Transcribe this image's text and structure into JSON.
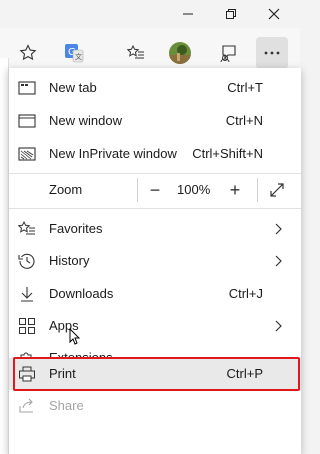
{
  "window": {
    "minimize_icon": "minimize-icon",
    "restore_icon": "restore-icon",
    "close_icon": "close-icon"
  },
  "toolbar": {
    "favorite_icon": "star-icon",
    "translate_icon": "translate-icon",
    "favorites_list_icon": "favorites-list-icon",
    "avatar_icon": "avatar",
    "feedback_icon": "feedback-icon",
    "more_icon": "more-icon"
  },
  "menu": {
    "items": [
      {
        "label": "New tab",
        "shortcut": "Ctrl+T",
        "icon": "new-tab-icon"
      },
      {
        "label": "New window",
        "shortcut": "Ctrl+N",
        "icon": "new-window-icon"
      },
      {
        "label": "New InPrivate window",
        "shortcut": "Ctrl+Shift+N",
        "icon": "inprivate-icon"
      }
    ],
    "zoom": {
      "label": "Zoom",
      "minus": "−",
      "value": "100%",
      "plus": "+",
      "fullscreen_icon": "fullscreen-icon"
    },
    "items2": [
      {
        "label": "Favorites",
        "icon": "favorites-icon",
        "has_arrow": true
      },
      {
        "label": "History",
        "icon": "history-icon",
        "has_arrow": true
      },
      {
        "label": "Downloads",
        "shortcut": "Ctrl+J",
        "icon": "downloads-icon"
      },
      {
        "label": "Apps",
        "icon": "apps-icon",
        "has_arrow": true
      },
      {
        "label": "Extensions",
        "icon": "extensions-icon"
      }
    ],
    "print": {
      "label": "Print",
      "shortcut": "Ctrl+P",
      "icon": "print-icon"
    },
    "share": {
      "label": "Share",
      "icon": "share-icon",
      "disabled": true
    }
  },
  "colors": {
    "highlight": "#e0171c",
    "menu_bg": "#ffffff",
    "accent": "#2b5797"
  }
}
